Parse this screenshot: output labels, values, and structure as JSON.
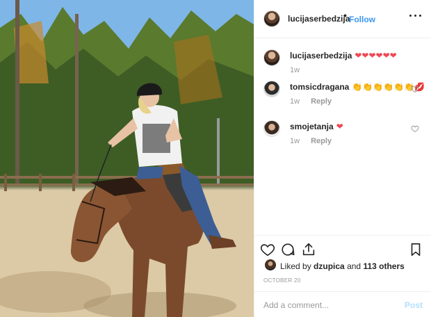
{
  "post": {
    "author": "lucijaserbedzija",
    "separator": "•",
    "follow_label": "Follow",
    "more_icon": "more-options-icon"
  },
  "comments": [
    {
      "user": "lucijaserbedzija",
      "text": "❤❤❤❤❤❤",
      "time": "1w",
      "reply": ""
    },
    {
      "user": "tomsicdragana",
      "text": "👏👏👏👏👏👏💋",
      "time": "1w",
      "reply": "Reply"
    },
    {
      "user": "smojetanja",
      "text": "❤",
      "time": "1w",
      "reply": "Reply"
    }
  ],
  "actions": {
    "like_icon": "heart-icon",
    "comment_icon": "comment-icon",
    "share_icon": "share-icon",
    "save_icon": "bookmark-icon"
  },
  "likes": {
    "prefix": "Liked by",
    "user": "dzupica",
    "joiner": "and",
    "others": "113 others"
  },
  "date": "OCTOBER 20",
  "add_comment": {
    "placeholder": "Add a comment...",
    "post_label": "Post"
  },
  "colors": {
    "link_blue": "#3897f0",
    "post_disabled": "#b2dffc",
    "heart_red": "#ed4956"
  }
}
